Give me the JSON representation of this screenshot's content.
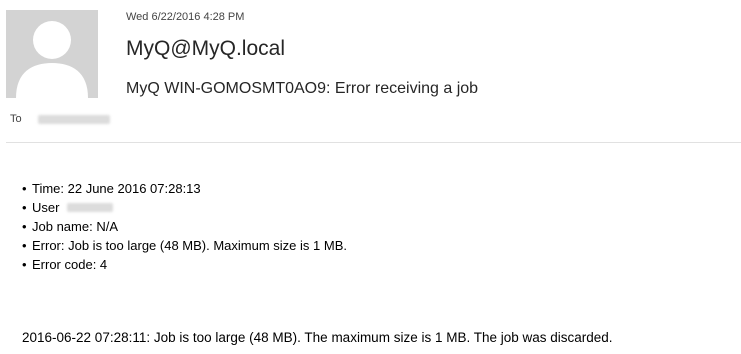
{
  "message": {
    "sent": "Wed 6/22/2016 4:28 PM",
    "sender": "MyQ@MyQ.local",
    "subject": "MyQ WIN-GOMOSMT0AO9: Error receiving a job",
    "to_label": "To"
  },
  "body": {
    "bullet": "•",
    "items": [
      "Time: 22 June 2016 07:28:13",
      "User",
      "Job name: N/A",
      "Error: Job is too large (48 MB). Maximum size is 1 MB.",
      "Error code: 4"
    ],
    "log_line": "2016-06-22 07:28:11: Job is too large (48 MB). The maximum size is 1 MB. The job was discarded."
  },
  "icons": {
    "avatar": "person-silhouette-icon"
  },
  "colors": {
    "avatar_bg": "#d3d3d3",
    "avatar_figure": "#ffffff",
    "divider": "#e1e1e1"
  }
}
